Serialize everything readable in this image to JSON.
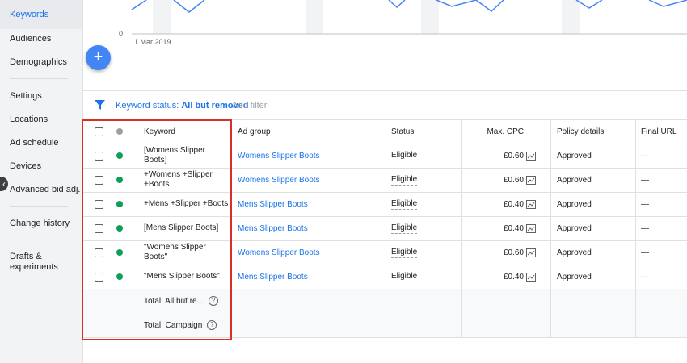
{
  "sidebar": {
    "items": [
      {
        "label": "Keywords",
        "active": true
      },
      {
        "label": "Audiences"
      },
      {
        "label": "Demographics"
      },
      {
        "label": "Settings"
      },
      {
        "label": "Locations"
      },
      {
        "label": "Ad schedule"
      },
      {
        "label": "Devices"
      },
      {
        "label": "Advanced bid adj."
      },
      {
        "label": "Change history"
      },
      {
        "label": "Drafts &\nexperiments"
      }
    ]
  },
  "chart": {
    "y_zero_label": "0",
    "x_date_label": "1 Mar 2019"
  },
  "fab": {
    "icon": "plus-icon",
    "glyph": "+"
  },
  "filter": {
    "prefix": "Keyword status: ",
    "value": "All but removed",
    "add_label": "Add filter"
  },
  "table": {
    "headers": {
      "keyword": "Keyword",
      "ad_group": "Ad group",
      "status": "Status",
      "max_cpc": "Max. CPC",
      "policy": "Policy details",
      "final_url": "Final URL"
    },
    "rows": [
      {
        "keyword": "[Womens Slipper Boots]",
        "ad_group": "Womens Slipper Boots",
        "status": "Eligible",
        "max_cpc": "£0.60",
        "policy": "Approved",
        "final_url": "—"
      },
      {
        "keyword": "+Womens +Slipper +Boots",
        "ad_group": "Womens Slipper Boots",
        "status": "Eligible",
        "max_cpc": "£0.60",
        "policy": "Approved",
        "final_url": "—"
      },
      {
        "keyword": "+Mens +Slipper +Boots",
        "ad_group": "Mens Slipper Boots",
        "status": "Eligible",
        "max_cpc": "£0.40",
        "policy": "Approved",
        "final_url": "—"
      },
      {
        "keyword": "[Mens Slipper Boots]",
        "ad_group": "Mens Slipper Boots",
        "status": "Eligible",
        "max_cpc": "£0.40",
        "policy": "Approved",
        "final_url": "—"
      },
      {
        "keyword": "\"Womens Slipper Boots\"",
        "ad_group": "Womens Slipper Boots",
        "status": "Eligible",
        "max_cpc": "£0.60",
        "policy": "Approved",
        "final_url": "—"
      },
      {
        "keyword": "\"Mens Slipper Boots\"",
        "ad_group": "Mens Slipper Boots",
        "status": "Eligible",
        "max_cpc": "£0.40",
        "policy": "Approved",
        "final_url": "—"
      }
    ],
    "totals": [
      {
        "label": "Total: All but re..."
      },
      {
        "label": "Total: Campaign"
      }
    ],
    "help_glyph": "?"
  },
  "colors": {
    "accent": "#1a73e8",
    "eligible_dot": "#0f9d58",
    "highlight_box": "#d93025",
    "fab": "#4285f4"
  }
}
